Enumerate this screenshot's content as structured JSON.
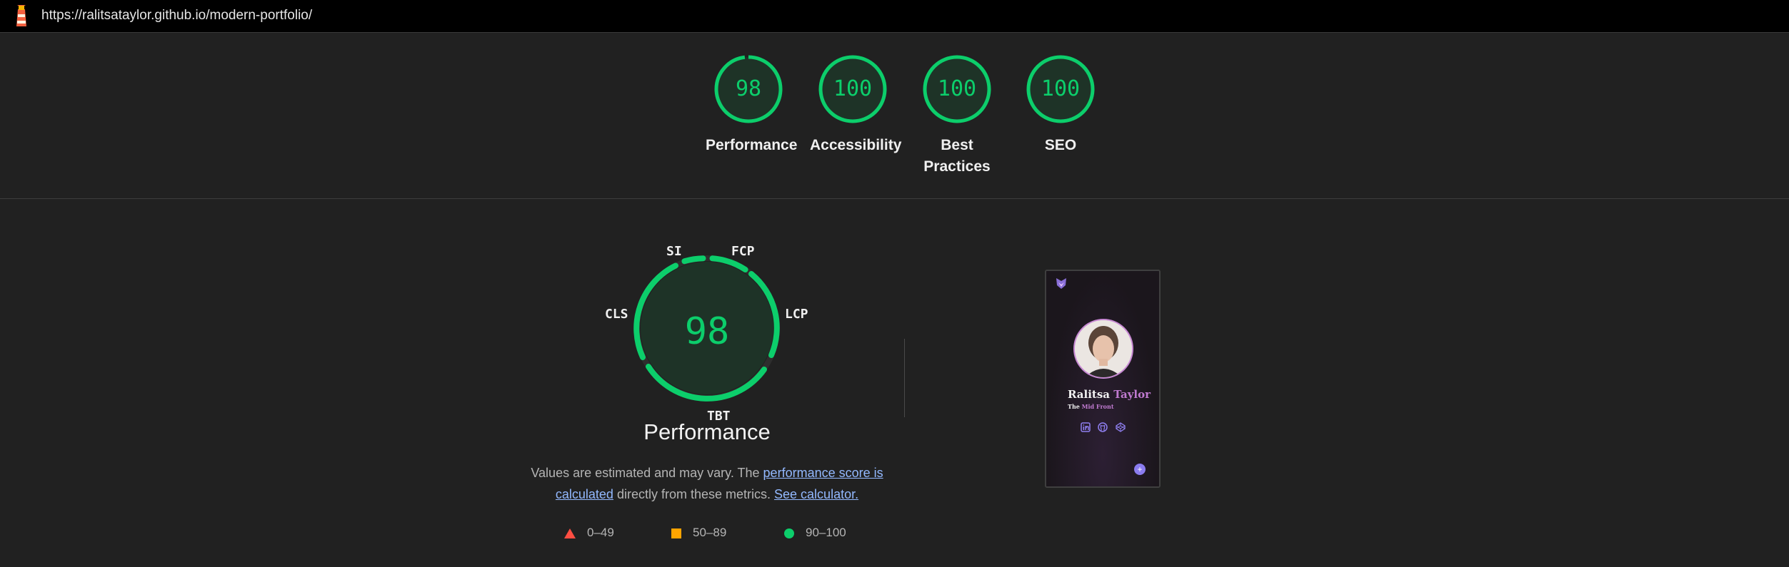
{
  "header": {
    "url": "https://ralitsataylor.github.io/modern-portfolio/",
    "logo_icon": "lighthouse-icon"
  },
  "colors": {
    "pass": "#0cce6b",
    "average": "#ffa400",
    "fail": "#ff4e42"
  },
  "gauges": [
    {
      "label": "Performance",
      "score": "98"
    },
    {
      "label": "Accessibility",
      "score": "100"
    },
    {
      "label": "Best Practices",
      "score": "100"
    },
    {
      "label": "SEO",
      "score": "100"
    }
  ],
  "performance": {
    "score": "98",
    "title": "Performance",
    "metrics": {
      "si": "SI",
      "fcp": "FCP",
      "lcp": "LCP",
      "tbt": "TBT",
      "cls": "CLS"
    },
    "description": {
      "before": "Values are estimated and may vary. The ",
      "link1": "performance score is calculated",
      "middle": " directly from these metrics. ",
      "link2": "See calculator."
    },
    "legend": [
      {
        "range": "0–49",
        "shape": "triangle"
      },
      {
        "range": "50–89",
        "shape": "square"
      },
      {
        "range": "90–100",
        "shape": "circle"
      }
    ]
  },
  "screenshot": {
    "first_name": "Ralitsa",
    "last_name": "Taylor",
    "tagline_prefix": "The",
    "tagline_highlight": "Mid Front",
    "icons": [
      "linkedin-icon",
      "github-icon",
      "codepen-icon"
    ]
  }
}
